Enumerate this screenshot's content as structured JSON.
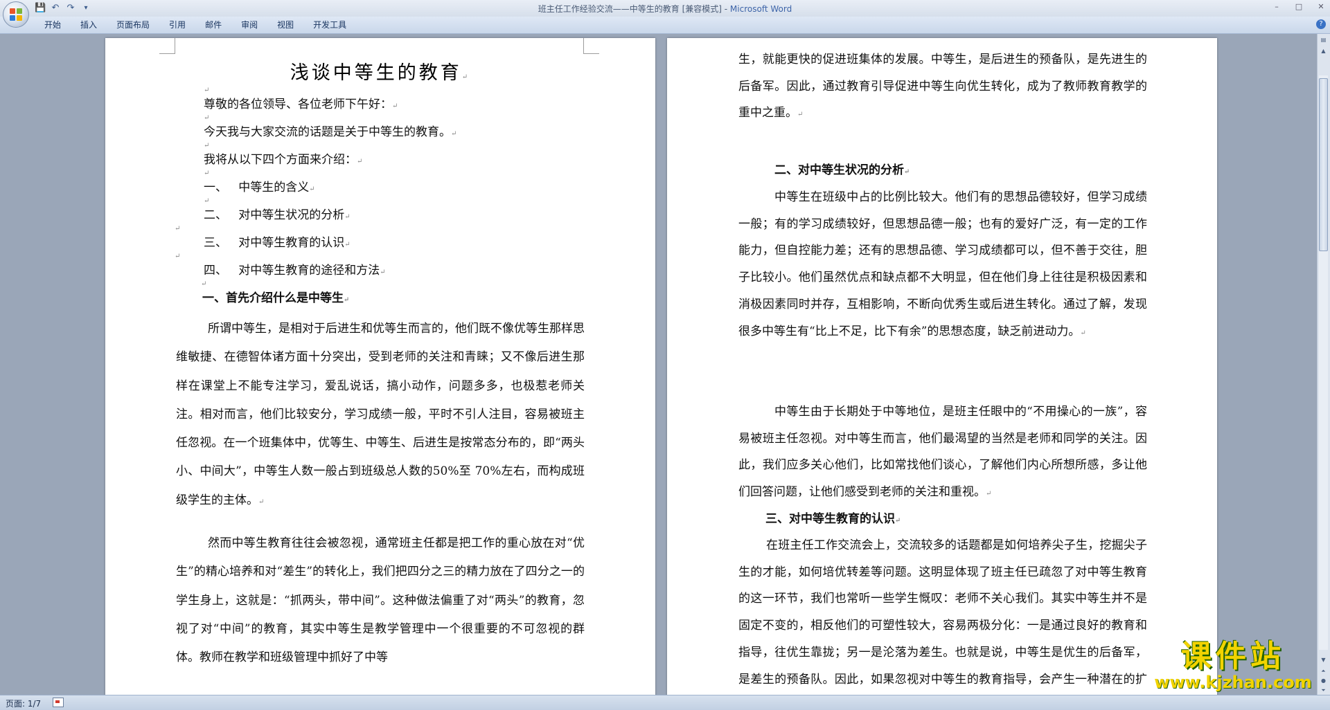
{
  "window": {
    "title_doc": "班主任工作经验交流——中等生的教育 [兼容模式] - ",
    "title_app": "Microsoft Word",
    "controls": [
      "–",
      "□",
      "✕"
    ]
  },
  "qat": {
    "save": "💾",
    "undo": "↶",
    "redo": "↷",
    "more": "▾"
  },
  "ribbon": {
    "tabs": [
      "开始",
      "插入",
      "页面布局",
      "引用",
      "邮件",
      "审阅",
      "视图",
      "开发工具"
    ],
    "help": "?"
  },
  "marks": {
    "para": "↵",
    "small": "↵"
  },
  "page1": {
    "title": "浅谈中等生的教育",
    "greeting": "尊敬的各位领导、各位老师下午好：",
    "topic": "今天我与大家交流的话题是关于中等生的教育。",
    "intro": "我将从以下四个方面来介绍：",
    "outline": [
      {
        "num": "一、",
        "text": "中等生的含义"
      },
      {
        "num": "二、",
        "text": "对中等生状况的分析"
      },
      {
        "num": "三、",
        "text": "对中等生教育的认识"
      },
      {
        "num": "四、",
        "text": "对中等生教育的途径和方法"
      }
    ],
    "heading1": "一、首先介绍什么是中等生",
    "para1": "所谓中等生，是相对于后进生和优等生而言的，他们既不像优等生那样思维敏捷、在德智体诸方面十分突出，受到老师的关注和青睐；又不像后进生那样在课堂上不能专注学习，爱乱说话，搞小动作，问题多多，也极惹老师关注。相对而言，他们比较安分，学习成绩一般，平时不引人注目，容易被班主任忽视。在一个班集体中，优等生、中等生、后进生是按常态分布的，即“两头小、中间大”，中等生人数一般占到班级总人数的50%至 70%左右，而构成班级学生的主体。",
    "para2": "然而中等生教育往往会被忽视，通常班主任都是把工作的重心放在对“优生”的精心培养和对“差生”的转化上，我们把四分之三的精力放在了四分之一的学生身上，这就是：“抓两头，带中间”。这种做法偏重了对“两头”的教育，忽视了对“中间”的教育，其实中等生是教学管理中一个很重要的不可忽视的群体。教师在教学和班级管理中抓好了中等"
  },
  "page2": {
    "para0": "生，就能更快的促进班集体的发展。中等生，是后进生的预备队，是先进生的后备军。因此，通过教育引导促进中等生向优生转化，成为了教师教育教学的重中之重。",
    "heading2": "二、对中等生状况的分析",
    "para1": "中等生在班级中占的比例比较大。他们有的思想品德较好，但学习成绩一般；有的学习成绩较好，但思想品德一般；也有的爱好广泛，有一定的工作能力，但自控能力差；还有的思想品德、学习成绩都可以，但不善于交往，胆子比较小。他们虽然优点和缺点都不大明显，但在他们身上往往是积极因素和消极因素同时并存，互相影响，不断向优秀生或后进生转化。通过了解，发现很多中等生有“比上不足，比下有余”的思想态度，缺乏前进动力。",
    "para2": "中等生由于长期处于中等地位，是班主任眼中的“不用操心的一族”，容易被班主任忽视。对中等生而言，他们最渴望的当然是老师和同学的关注。因此，我们应多关心他们，比如常找他们谈心，了解他们内心所想所感，多让他们回答问题，让他们感受到老师的关注和重视。",
    "heading3": "三、对中等生教育的认识",
    "para3": "在班主任工作交流会上，交流较多的话题都是如何培养尖子生，挖掘尖子生的才能，如何培优转差等问题。这明显体现了班主任已疏忽了对中等生教育的这一环节，我们也常听一些学生慨叹：老师不关心我们。其实中等生并不是固定不变的，相反他们的可塑性较大，容易两极分化：一是通过良好的教育和指导，往优生靠拢；另一是沦落为差生。也就是说，中等生是优生的后备军，是差生的预备队。因此，如果忽视对中等生的教育指导，会产生一种潜在的扩大差生队伍的危险。若有针对性地对中等生"
  },
  "status": {
    "page": "页面: 1/7"
  },
  "watermark": {
    "text": "课件站",
    "url": "www.kjzhan.com"
  }
}
